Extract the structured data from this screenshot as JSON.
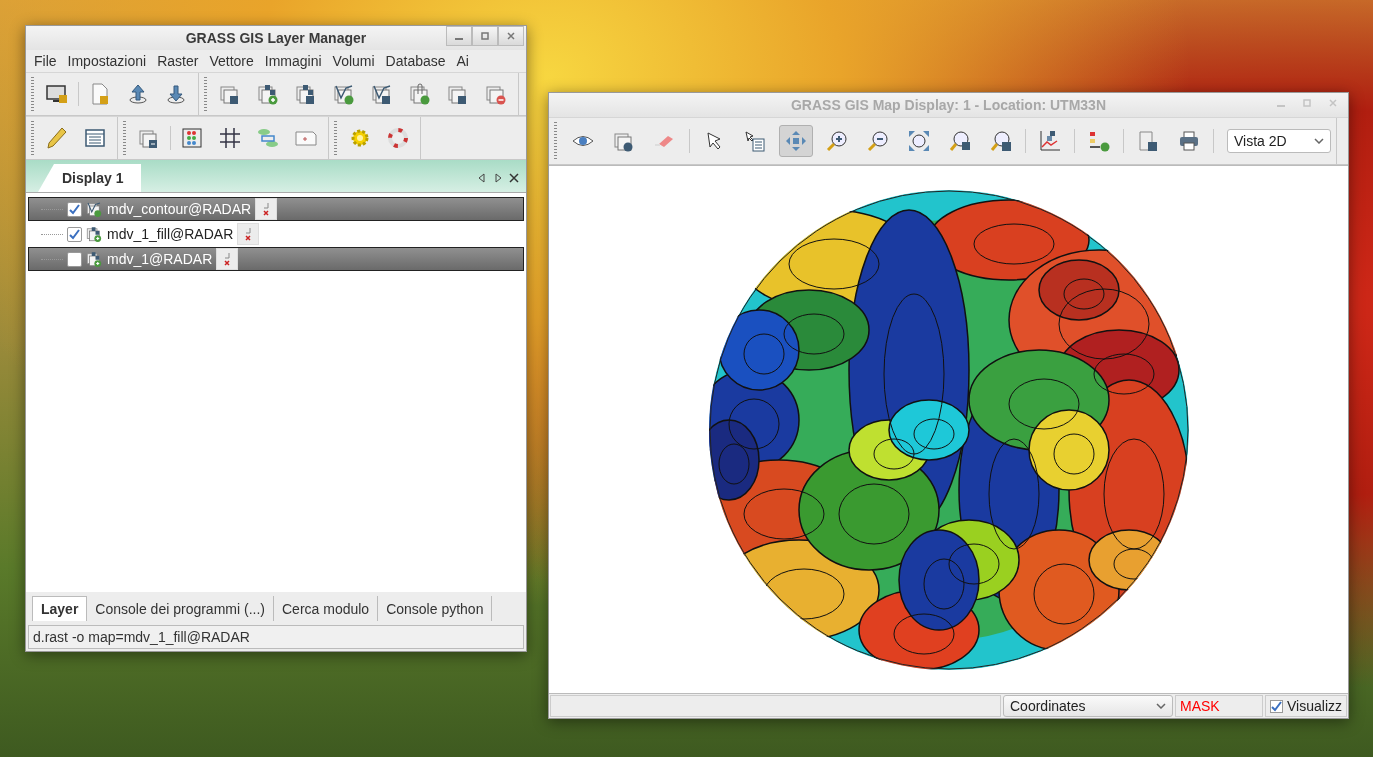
{
  "layer_manager": {
    "title": "GRASS GIS Layer Manager",
    "menu": [
      "File",
      "Impostazioni",
      "Raster",
      "Vettore",
      "Immagini",
      "Volumi",
      "Database",
      "Ai"
    ],
    "display_tab": {
      "label": "Display 1",
      "selected": true
    },
    "layers": [
      {
        "name": "mdv_contour@RADAR",
        "kind": "vector",
        "checked": true,
        "selected": true
      },
      {
        "name": "mdv_1_fill@RADAR",
        "kind": "raster",
        "checked": true,
        "selected": false
      },
      {
        "name": "mdv_1@RADAR",
        "kind": "raster",
        "checked": false,
        "selected": true
      }
    ],
    "bottom_tabs": [
      {
        "label": "Layer",
        "selected": true
      },
      {
        "label": "Console dei programmi (...)",
        "selected": false
      },
      {
        "label": "Cerca modulo",
        "selected": false
      },
      {
        "label": "Console python",
        "selected": false
      }
    ],
    "status_bar": "d.rast -o map=mdv_1_fill@RADAR"
  },
  "map_display": {
    "title": "GRASS GIS Map Display: 1 - Location: UTM33N",
    "tools": [
      {
        "selected": false
      },
      {
        "selected": false
      },
      {
        "selected": false
      },
      {
        "selected": false
      },
      {
        "selected": false
      },
      {
        "selected": true
      },
      {
        "selected": false
      },
      {
        "selected": false
      },
      {
        "selected": false
      },
      {
        "selected": false
      },
      {
        "selected": false
      },
      {
        "selected": false
      },
      {
        "selected": false
      },
      {
        "selected": false
      },
      {
        "selected": false
      }
    ],
    "view_mode": "Vista 2D",
    "status_bar": {
      "coordinates_mode": "Coordinates",
      "mask": "MASK",
      "render": {
        "label": "Visualizz",
        "checked": true
      }
    }
  }
}
